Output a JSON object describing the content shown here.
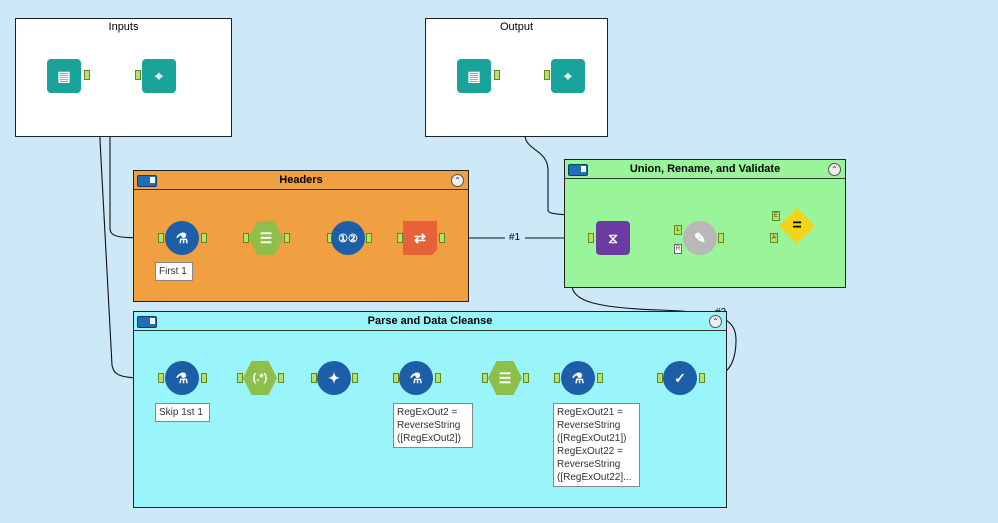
{
  "containers": {
    "inputs": {
      "title": "Inputs"
    },
    "output": {
      "title": "Output"
    },
    "headers": {
      "title": "Headers"
    },
    "union": {
      "title": "Union, Rename, and Validate"
    },
    "parse": {
      "title": "Parse and Data Cleanse"
    }
  },
  "connection_labels": {
    "c1": "#1",
    "c2": "#2"
  },
  "annotations": {
    "first": "First 1",
    "skip": "Skip 1st 1",
    "regex2": [
      "RegExOut2 =",
      "ReverseString",
      "([RegExOut2])"
    ],
    "regex21": [
      "RegExOut21 =",
      "ReverseString",
      "([RegExOut21])",
      "RegExOut22 =",
      "ReverseString",
      "([RegExOut22]..."
    ]
  },
  "anchors": {
    "L": "L",
    "R": "R",
    "E": "E",
    "A": "A"
  },
  "colors": {
    "canvas": "#cde9f8",
    "headers_bg": "#f0a040",
    "union_bg": "#9af59a",
    "parse_bg": "#9af5fa",
    "io_teal": "#1aa39a",
    "prep_blue": "#1d5ea8",
    "parse_green": "#8dbf4a",
    "transform_orange": "#e8613a",
    "join_purple": "#6c3aa0",
    "test_yellow": "#f2d41a"
  },
  "icons": [
    "input-book-icon",
    "browse-binoculars-icon",
    "sample-flask-icon",
    "text-to-columns-icon",
    "record-id-icon",
    "transpose-icon",
    "regex-icon",
    "cleanse-icon",
    "formula-icon",
    "data-cleansing-icon",
    "union-dna-icon",
    "dynamic-rename-icon",
    "test-icon"
  ]
}
